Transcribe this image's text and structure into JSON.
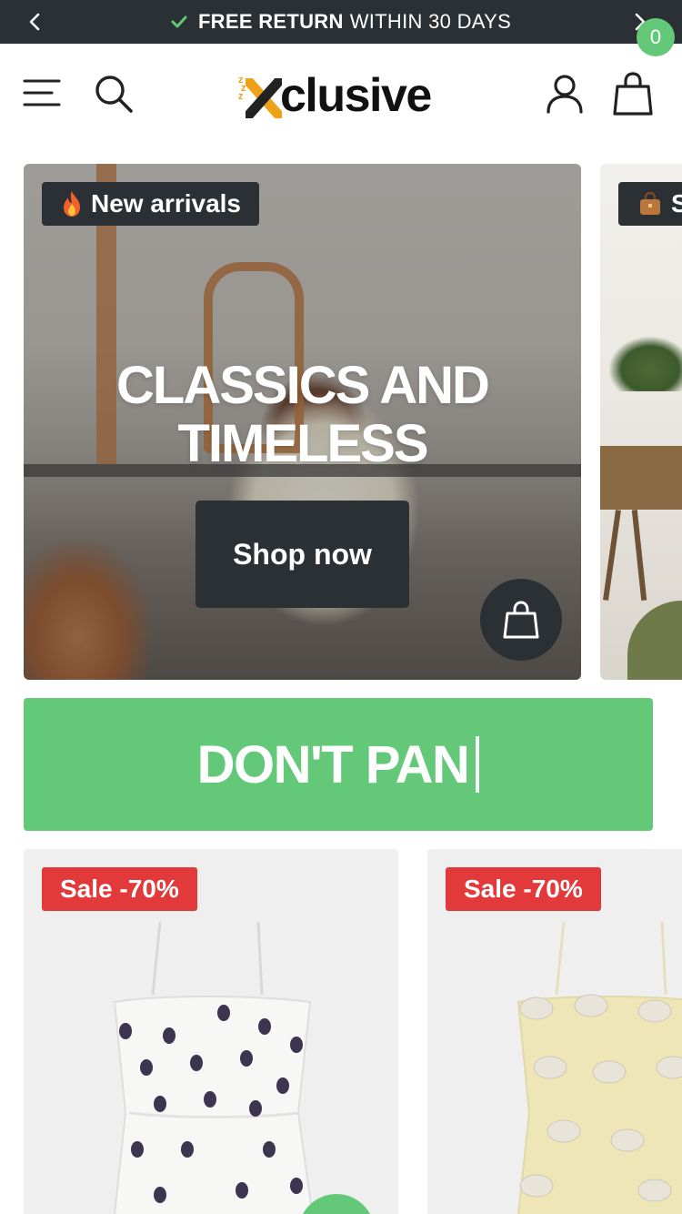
{
  "announcement": {
    "bold": "FREE RETURN",
    "text": "WITHIN 30 DAYS"
  },
  "header": {
    "logo_text": "clusive",
    "cart_count": "0"
  },
  "hero": {
    "badge": "New arrivals",
    "title_line1": "CLASSICS AND",
    "title_line2": "TIMELESS",
    "button": "Shop now",
    "next_badge": "S"
  },
  "marquee": {
    "text": "DON'T PAN"
  },
  "products": [
    {
      "sale": "Sale -70%"
    },
    {
      "sale": "Sale -70%"
    }
  ],
  "colors": {
    "dark": "#2b3035",
    "accent_green": "#63c979",
    "sale_red": "#e23a3b",
    "logo_orange": "#f0a11a"
  },
  "icons": [
    "chevron-left-icon",
    "check-icon",
    "chevron-right-icon",
    "menu-icon",
    "search-icon",
    "user-icon",
    "shopping-bag-icon",
    "fire-icon",
    "handbag-icon"
  ]
}
